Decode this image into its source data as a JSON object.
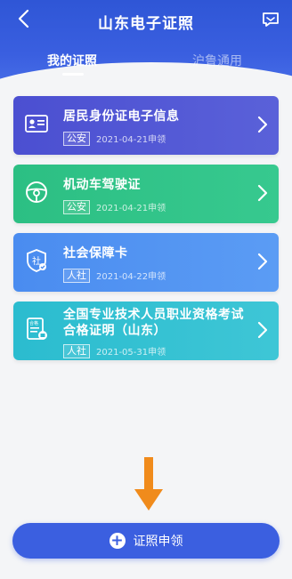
{
  "header": {
    "title": "山东电子证照",
    "tabs": [
      {
        "label": "我的证照",
        "active": true
      },
      {
        "label": "沪鲁通用",
        "active": false
      }
    ],
    "back_icon": "back-chevron-icon",
    "message_icon": "chat-message-icon"
  },
  "cards": [
    {
      "name": "居民身份证电子信息",
      "tag": "公安",
      "date": "2021-04-21申领",
      "icon": "id-card-icon",
      "color": "#4a4fd0"
    },
    {
      "name": "机动车驾驶证",
      "tag": "公安",
      "date": "2021-04-21申领",
      "icon": "steering-wheel-icon",
      "color": "#2fbf84"
    },
    {
      "name": "社会保障卡",
      "tag": "人社",
      "date": "2021-04-22申领",
      "icon": "social-security-shield-icon",
      "color": "#4f8ef0"
    },
    {
      "name": "全国专业技术人员职业资格考试合格证明（山东）",
      "tag": "人社",
      "date": "2021-05-31申领",
      "icon": "certificate-icon",
      "color": "#2fbdd0"
    }
  ],
  "apply_button": {
    "label": "证照申领",
    "icon": "plus-circle-icon"
  },
  "accent_arrow_color": "#f08b1c"
}
